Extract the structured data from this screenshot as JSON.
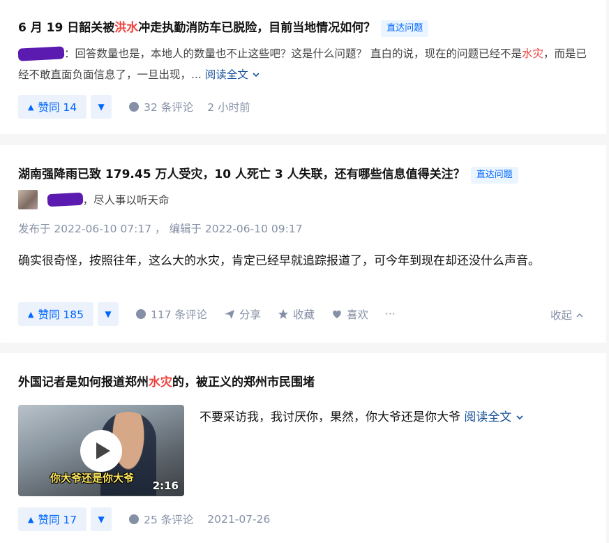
{
  "card1": {
    "title_pre": "6 月 19 日韶关被",
    "title_hl": "洪水",
    "title_post": "冲走执勤消防车已脱险，目前当地情况如何？",
    "tag": "直达问题",
    "author": "出网友怎",
    "excerpt_a": "：回答数量也是，本地人的数量也不止这些吧？这是什么问题？ 直白的说，现在的问题已经不是",
    "excerpt_hl": "水灾",
    "excerpt_b": "，而是已经不敢直面负面信息了，一旦出现，...",
    "readmore": "阅读全文",
    "upvote": "赞同 14",
    "comments": "32 条评论",
    "time": "2 小时前"
  },
  "card2": {
    "title": "湖南强降雨已致 179.45 万人受灾，10 人死亡 3 人失联，还有哪些信息值得关注？",
    "tag": "直达问题",
    "author": "风中客",
    "bio": "，尽人事以听天命",
    "meta": "发布于 2022-06-10 07:17 ， 编辑于 2022-06-10 09:17",
    "body": "确实很奇怪，按照往年，这么大的水灾，肯定已经早就追踪报道了，可今年到现在却还没什么声音。",
    "upvote": "赞同 185",
    "comments": "117 条评论",
    "share": "分享",
    "favorite": "收藏",
    "like": "喜欢",
    "more": "···",
    "collapse": "收起"
  },
  "card3": {
    "title_pre": "外国记者是如何报道郑州",
    "title_hl": "水灾",
    "title_post": "的，被正义的郑州市民围堵",
    "video_caption": "你大爷还是你大爷",
    "duration": "2:16",
    "excerpt": "不要采访我，我讨厌你，果然，你大爷还是你大爷",
    "readmore": "阅读全文",
    "upvote": "赞同 17",
    "comments": "25 条评论",
    "time": "2021-07-26"
  },
  "colors": {
    "accent": "#0066ff",
    "highlight": "#f1403c",
    "muted": "#8590a6"
  }
}
